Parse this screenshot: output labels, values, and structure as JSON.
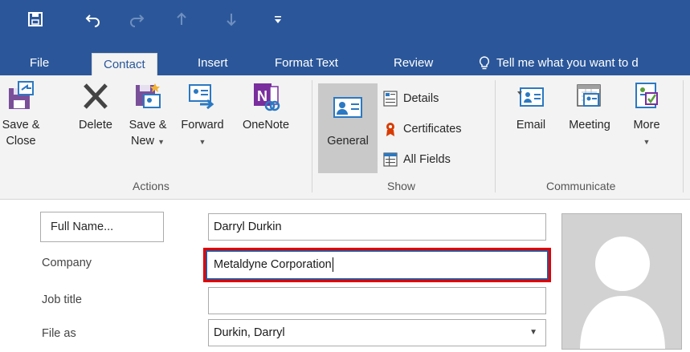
{
  "quick_access": {
    "icons": [
      "save-icon",
      "undo-icon",
      "redo-icon",
      "previous-item-icon",
      "next-item-icon",
      "customize-qat-icon"
    ]
  },
  "tabs": [
    {
      "label": "File"
    },
    {
      "label": "Contact"
    },
    {
      "label": "Insert"
    },
    {
      "label": "Format Text"
    },
    {
      "label": "Review"
    }
  ],
  "tell_me": "Tell me what you want to d",
  "ribbon": {
    "actions": {
      "save_close": [
        "Save &",
        "Close"
      ],
      "delete": "Delete",
      "save_new": [
        "Save &",
        "New"
      ],
      "forward": "Forward",
      "onenote": "OneNote",
      "group_label": "Actions"
    },
    "show": {
      "general": "General",
      "details": "Details",
      "certificates": "Certificates",
      "all_fields": "All Fields",
      "group_label": "Show"
    },
    "communicate": {
      "email": "Email",
      "meeting": "Meeting",
      "more": "More",
      "group_label": "Communicate"
    }
  },
  "form": {
    "full_name_button": "Full Name...",
    "full_name_value": "Darryl Durkin",
    "company_label": "Company",
    "company_value": "Metaldyne Corporation",
    "job_title_label": "Job title",
    "job_title_value": "",
    "file_as_label": "File as",
    "file_as_value": "Durkin, Darryl"
  },
  "colors": {
    "accent": "#2b579a",
    "ribbon_bg": "#f3f3f3",
    "highlight_border": "#e00000"
  }
}
